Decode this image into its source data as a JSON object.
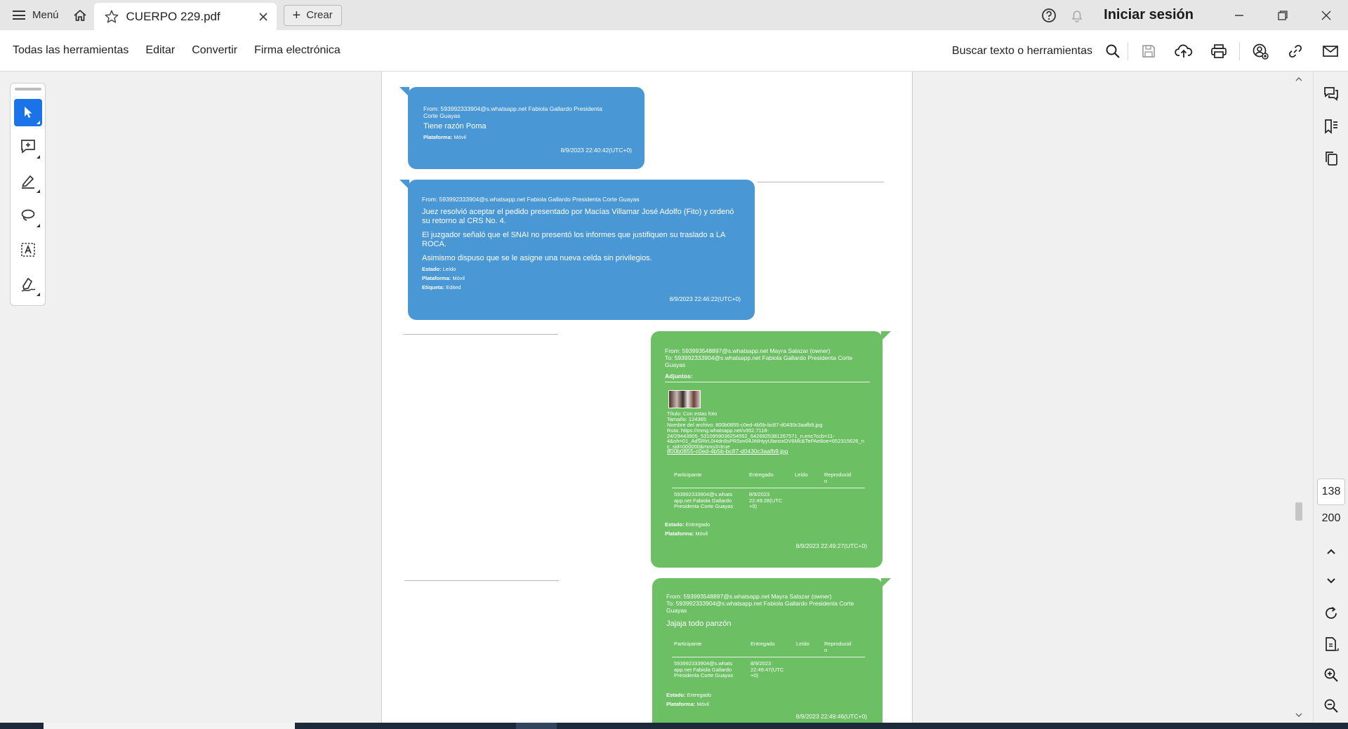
{
  "titlebar": {
    "menu_label": "Menú",
    "tab_title": "CUERPO 229.pdf",
    "create_label": "Crear",
    "signin_label": "Iniciar sesión"
  },
  "toolbar": {
    "all_tools": "Todas las herramientas",
    "edit": "Editar",
    "convert": "Convertir",
    "esign": "Firma electrónica",
    "search": "Buscar texto o herramientas"
  },
  "navigation": {
    "current_page": "138",
    "total_pages": "200"
  },
  "messages": [
    {
      "from": "From: 593992333904@s.whatsapp.net Fabiola Gallardo Presidenta\nCorte Guayas",
      "body": "Tiene razón Poma",
      "platform_label": "Plataforma:",
      "platform_value": "Móvil",
      "timestamp": "8/9/2023 22:40:42(UTC+0)"
    },
    {
      "from": "From: 593992333904@s.whatsapp.net Fabiola Gallardo Presidenta Corte Guayas",
      "body1": "Juez resolvió aceptar el pedido presentado por Macías Villamar José Adolfo (Fito) y ordenó\nsu retorno al CRS No. 4.",
      "body2": "El juzgador señaló que el SNAI no presentó los informes que justifiquen su traslado a LA\nROCA.",
      "body3": "Asimismo dispuso que se le asigne una nueva celda sin privilegios.",
      "state_label": "Estado:",
      "state_value": "Leído",
      "platform_label": "Plataforma:",
      "platform_value": "Móvil",
      "tag_label": "Etiqueta:",
      "tag_value": "Edited",
      "timestamp": "8/9/2023 22:46:22(UTC+0)"
    },
    {
      "from": "From: 593993548897@s.whatsapp.net Mayra Salazar (owner)\nTo: 593992333904@s.whatsapp.net Fabiola Gallardo Presidenta Corte\nGuayas",
      "attachments_label": "Adjuntos:",
      "file_info": "Título: Con estas foto\nTamaño: 124365\nNombre del archivo: 800b0855-c0ed-4b5b-bc87-d0430c3aafb9.jpg\nRuta: https://mmg.whatsapp.net/v/t62.7118-\n24/29443905_5310959036254552_6426925381267571_n.enc?ccb=11-\n4&oh=01_AdSRlrL0I4dn8sPR5ov04JiNHyyUlanoxDV6Mc&TePAe8oe=652315626_n\nc_sid=000000&mms3=true",
      "file_link": "800b0855-c0ed-4b5b-bc87-d0430c3aafb9.jpg",
      "table_headers": [
        "Participante",
        "Entregado",
        "Leído",
        "Reproducid\no"
      ],
      "participant": "593992333904@s.whats\napp.net Fabiola Gallardo\nPresidenta Corte Guayas",
      "delivered": "8/9/2023\n22:49:28(UTC\n+0)",
      "state_label": "Estado:",
      "state_value": "Entregado",
      "platform_label": "Plataforma:",
      "platform_value": "Móvil",
      "timestamp": "8/9/2023 22:49:27(UTC+0)"
    },
    {
      "from": "From: 593993548897@s.whatsapp.net Mayra Salazar (owner)\nTo: 593992333904@s.whatsapp.net Fabiola Gallardo Presidenta Corte\nGuayas",
      "body": "Jajaja todo panzón",
      "table_headers": [
        "Participante",
        "Entregado",
        "Leído",
        "Reproducid\no"
      ],
      "participant": "593992333904@s.whats\napp.net Fabiola Gallardo\nPresidenta Corte Guayas",
      "delivered": "8/9/2023\n22:49:47(UTC\n+0)",
      "state_label": "Estado:",
      "state_value": "Entregado",
      "platform_label": "Plataforma:",
      "platform_value": "Móvil",
      "timestamp": "8/9/2023 22:49:46(UTC+0)"
    }
  ],
  "icons": {
    "home": "home-icon",
    "star": "star-icon",
    "close": "close-icon",
    "help": "help-icon",
    "bell": "bell-icon",
    "search": "search-icon",
    "save": "save-icon",
    "upload": "cloud-upload-icon",
    "print": "print-icon",
    "share": "share-user-icon",
    "link": "link-icon",
    "mail": "mail-icon"
  },
  "colors": {
    "accent": "#1a73e8",
    "bubble_blue": "#4a97d6",
    "bubble_green": "#6cbf63"
  }
}
